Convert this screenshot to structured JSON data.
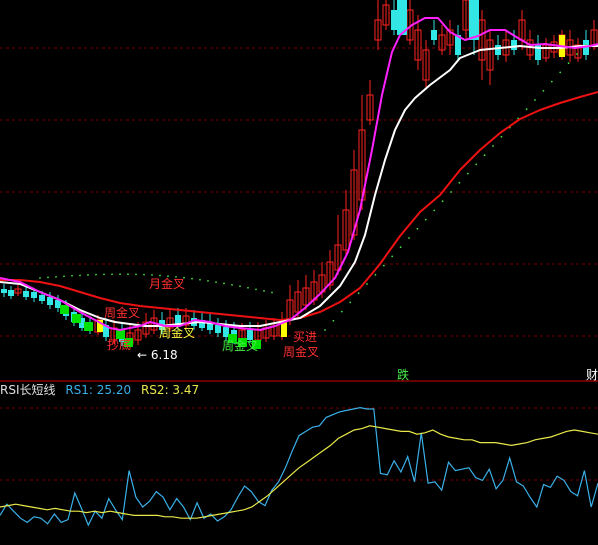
{
  "chart_data": [
    {
      "type": "candlestick",
      "colors": {
        "background": "#000000",
        "grid": "#7a0000",
        "up": "#ff2222",
        "down": "#33e6e6",
        "ma_short": "#ffffff",
        "ma_mid": "#ff22ff",
        "ma_long": "#ee1111",
        "signal_yellow": "#ffff00",
        "bottom_box": "#00e000",
        "dots": "#44dd44"
      },
      "annotations": {
        "month_cross": "月金叉",
        "week_cross_1": "周金叉",
        "week_cross_2": "周金叉",
        "week_cross_3": "周金叉",
        "week_cross_4": "周金叉",
        "buy": "买进",
        "bottom": "抄底",
        "low_price": "← 6.18",
        "drop_1": "跌",
        "drop_2": "财"
      }
    },
    {
      "type": "line",
      "title": "RSI长短线",
      "series": [
        {
          "name": "RS1",
          "current": "25.20",
          "color": "#3ab0e8",
          "values": [
            14,
            22,
            17,
            12,
            9,
            13,
            12,
            8,
            15,
            9,
            11,
            30,
            19,
            7,
            17,
            12,
            26,
            18,
            11,
            46,
            27,
            20,
            24,
            31,
            27,
            18,
            26,
            20,
            11,
            23,
            12,
            15,
            10,
            13,
            18,
            27,
            35,
            31,
            24,
            21,
            32,
            38,
            48,
            60,
            71,
            74,
            77,
            78,
            84,
            86,
            88,
            89,
            90,
            91,
            90,
            90,
            44,
            43,
            53,
            45,
            56,
            38,
            73,
            37,
            38,
            32,
            52,
            46,
            47,
            48,
            41,
            39,
            47,
            33,
            39,
            55,
            38,
            35,
            27,
            20,
            36,
            34,
            42,
            39,
            31,
            28,
            46,
            20,
            37
          ]
        },
        {
          "name": "RS2",
          "current": "3.47",
          "color": "#e8e84a",
          "values": [
            20,
            21,
            22,
            21,
            20,
            19,
            18,
            19,
            18,
            17,
            17,
            16,
            17,
            16,
            17,
            16,
            15,
            14,
            14,
            14,
            14,
            13,
            13,
            12,
            12,
            12,
            13,
            14,
            15,
            16,
            17,
            18,
            20,
            24,
            28,
            33,
            38,
            43,
            48,
            52,
            56,
            60,
            64,
            69,
            72,
            75,
            76,
            78,
            77,
            76,
            75,
            74,
            74,
            72,
            73,
            75,
            72,
            70,
            69,
            68,
            68,
            66,
            66,
            66,
            65,
            64,
            65,
            66,
            68,
            69,
            70,
            72,
            74,
            75,
            74,
            73,
            72
          ]
        }
      ],
      "ylim": [
        0,
        100
      ]
    }
  ]
}
